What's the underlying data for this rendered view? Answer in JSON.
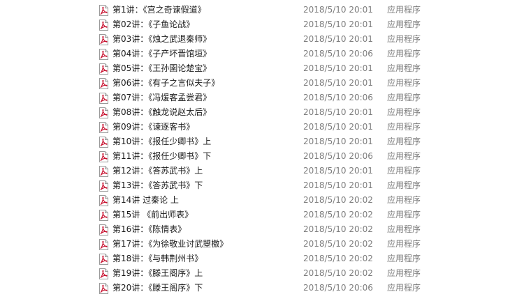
{
  "files": [
    {
      "name": "第1讲：《宫之奇谏假道》",
      "modified": "2018/5/10 20:01",
      "type": "应用程序",
      "icon": "pdf-file-icon"
    },
    {
      "name": "第02讲：《子鱼论战》",
      "modified": "2018/5/10 20:01",
      "type": "应用程序",
      "icon": "pdf-file-icon"
    },
    {
      "name": "第03讲：《烛之武退秦师》",
      "modified": "2018/5/10 20:01",
      "type": "应用程序",
      "icon": "pdf-file-icon"
    },
    {
      "name": "第04讲：《子产坏晋馆垣》",
      "modified": "2018/5/10 20:06",
      "type": "应用程序",
      "icon": "pdf-file-icon"
    },
    {
      "name": "第05讲：《王孙圉论楚宝》",
      "modified": "2018/5/10 20:01",
      "type": "应用程序",
      "icon": "pdf-file-icon"
    },
    {
      "name": "第06讲：《有子之言似夫子》",
      "modified": "2018/5/10 20:01",
      "type": "应用程序",
      "icon": "pdf-file-icon"
    },
    {
      "name": "第07讲：《冯煖客孟尝君》",
      "modified": "2018/5/10 20:06",
      "type": "应用程序",
      "icon": "pdf-file-icon"
    },
    {
      "name": "第08讲：《触龙说赵太后》",
      "modified": "2018/5/10 20:01",
      "type": "应用程序",
      "icon": "pdf-file-icon"
    },
    {
      "name": "第09讲：《谏逐客书》",
      "modified": "2018/5/10 20:01",
      "type": "应用程序",
      "icon": "pdf-file-icon"
    },
    {
      "name": "第10讲：《报任少卿书》上",
      "modified": "2018/5/10 20:01",
      "type": "应用程序",
      "icon": "pdf-file-icon"
    },
    {
      "name": "第11讲：《报任少卿书》下",
      "modified": "2018/5/10 20:06",
      "type": "应用程序",
      "icon": "pdf-file-icon"
    },
    {
      "name": "第12讲：《答苏武书》上",
      "modified": "2018/5/10 20:01",
      "type": "应用程序",
      "icon": "pdf-file-icon"
    },
    {
      "name": "第13讲：《答苏武书》下",
      "modified": "2018/5/10 20:01",
      "type": "应用程序",
      "icon": "pdf-file-icon"
    },
    {
      "name": "第14讲  过秦论 上",
      "modified": "2018/5/10 20:02",
      "type": "应用程序",
      "icon": "pdf-file-icon"
    },
    {
      "name": "第15讲 《前出师表》",
      "modified": "2018/5/10 20:02",
      "type": "应用程序",
      "icon": "pdf-file-icon"
    },
    {
      "name": "第16讲：《陈情表》",
      "modified": "2018/5/10 20:02",
      "type": "应用程序",
      "icon": "pdf-file-icon"
    },
    {
      "name": "第17讲：《为徐敬业讨武曌檄》",
      "modified": "2018/5/10 20:02",
      "type": "应用程序",
      "icon": "pdf-file-icon"
    },
    {
      "name": "第18讲：《与韩荆州书》",
      "modified": "2018/5/10 20:02",
      "type": "应用程序",
      "icon": "pdf-file-icon"
    },
    {
      "name": "第19讲：《滕王阁序》上",
      "modified": "2018/5/10 20:02",
      "type": "应用程序",
      "icon": "pdf-file-icon"
    },
    {
      "name": "第20讲：《滕王阁序》下",
      "modified": "2018/5/10 20:06",
      "type": "应用程序",
      "icon": "pdf-file-icon"
    }
  ],
  "colors": {
    "name_text": "#1a1a1a",
    "meta_text": "#7d7d7d",
    "icon_red": "#c8102e",
    "background": "#ffffff"
  }
}
